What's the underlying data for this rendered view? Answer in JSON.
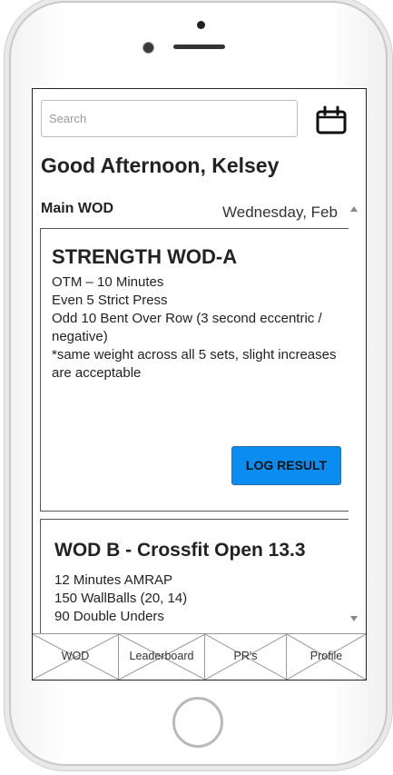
{
  "search": {
    "placeholder": "Search"
  },
  "greeting": "Good Afternoon, Kelsey",
  "section_label": "Main WOD",
  "date_label": "Wednesday, Feb",
  "workouts": [
    {
      "title": "STRENGTH WOD-A",
      "lines": [
        "OTM – 10 Minutes",
        "Even 5 Strict Press",
        "Odd 10 Bent Over Row (3 second eccentric / negative)",
        "*same weight across all 5 sets, slight increases are acceptable"
      ],
      "button": "LOG RESULT"
    },
    {
      "title": "WOD B - Crossfit Open 13.3",
      "lines": [
        "12 Minutes AMRAP",
        "150 WallBalls (20, 14)",
        "90 Double Unders"
      ]
    }
  ],
  "tabs": [
    "WOD",
    "Leaderboard",
    "PR's",
    "Profile"
  ],
  "icons": {
    "calendar": "calendar-icon"
  },
  "colors": {
    "primary_button": "#0a8cf0"
  }
}
